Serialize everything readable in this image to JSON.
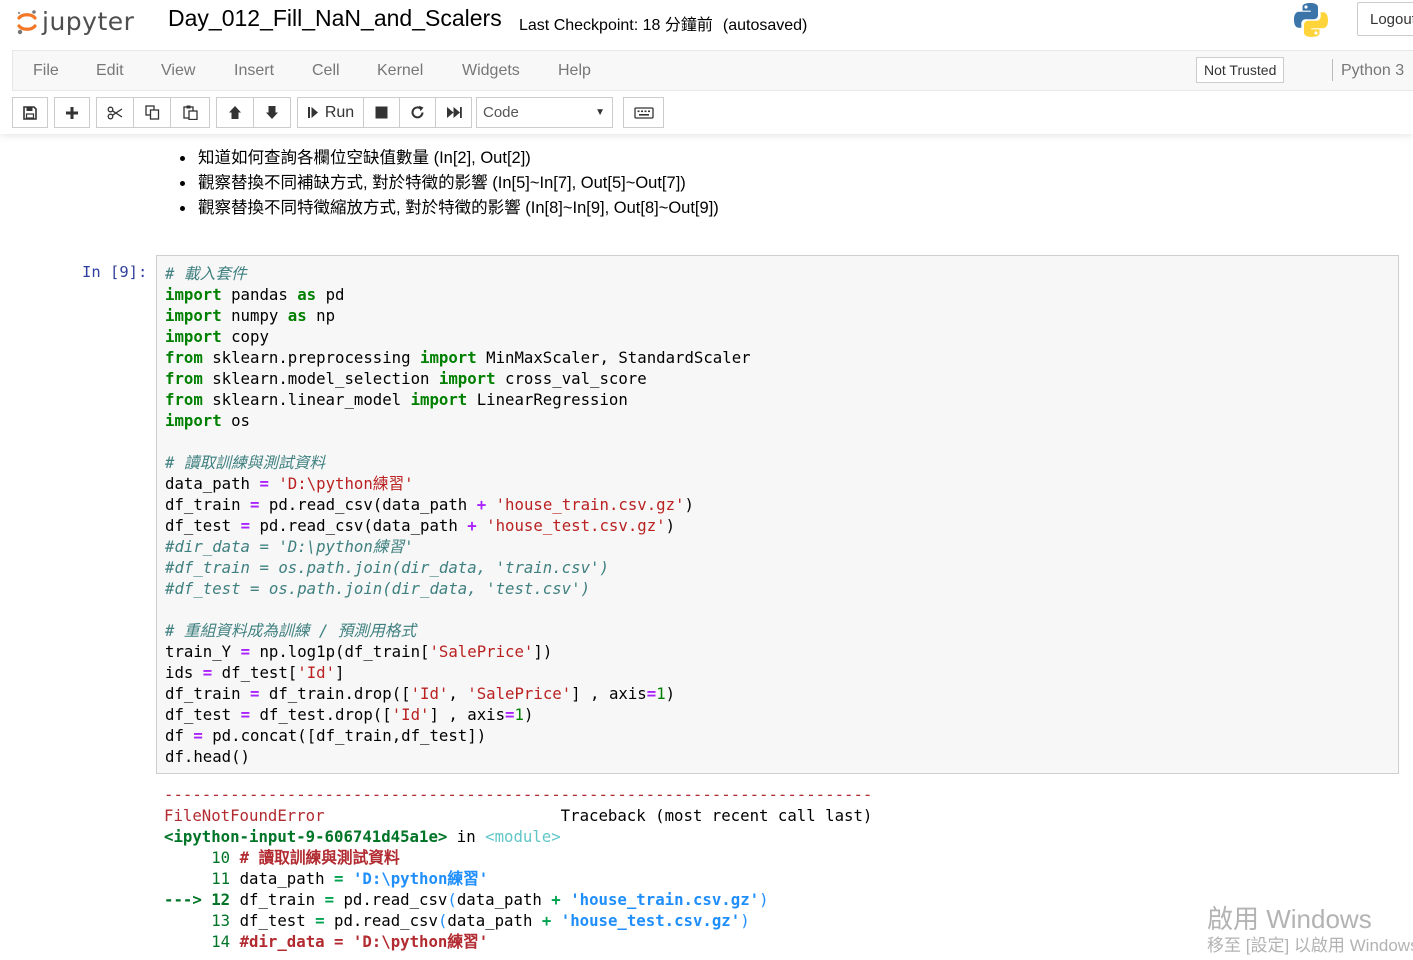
{
  "header": {
    "logo_text": "jupyter",
    "notebook_title": "Day_012_Fill_NaN_and_Scalers",
    "checkpoint_text": "Last Checkpoint: 18 分鐘前",
    "autosave_text": "(autosaved)",
    "logout_label": "Logout"
  },
  "menubar": {
    "items": [
      "File",
      "Edit",
      "View",
      "Insert",
      "Cell",
      "Kernel",
      "Widgets",
      "Help"
    ],
    "trust_label": "Not Trusted",
    "kernel_label": "Python 3"
  },
  "toolbar": {
    "run_label": "Run",
    "cell_type": "Code",
    "icons": [
      "save-icon",
      "plus-icon",
      "cut-icon",
      "copy-icon",
      "paste-icon",
      "arrow-up-icon",
      "arrow-down-icon",
      "run-icon",
      "stop-icon",
      "restart-icon",
      "fast-forward-icon",
      "keyboard-icon"
    ]
  },
  "markdown": {
    "bullets": [
      "知道如何查詢各欄位空缺值數量 (In[2], Out[2])",
      "觀察替換不同補缺方式, 對於特徵的影響 (In[5]~In[7], Out[5]~Out[7])",
      "觀察替換不同特徵縮放方式, 對於特徵的影響 (In[8]~In[9], Out[8]~Out[9])"
    ]
  },
  "cell": {
    "prompt": "In [9]:",
    "code_lines": [
      "# 載入套件",
      "import pandas as pd",
      "import numpy as np",
      "import copy",
      "from sklearn.preprocessing import MinMaxScaler, StandardScaler",
      "from sklearn.model_selection import cross_val_score",
      "from sklearn.linear_model import LinearRegression",
      "import os",
      "",
      "# 讀取訓練與測試資料",
      "data_path = 'D:\\python練習'",
      "df_train = pd.read_csv(data_path + 'house_train.csv.gz')",
      "df_test = pd.read_csv(data_path + 'house_test.csv.gz')",
      "#dir_data = 'D:\\python練習'",
      "#df_train = os.path.join(dir_data, 'train.csv')",
      "#df_test = os.path.join(dir_data, 'test.csv')",
      "",
      "# 重組資料成為訓練 / 預測用格式",
      "train_Y = np.log1p(df_train['SalePrice'])",
      "ids = df_test['Id']",
      "df_train = df_train.drop(['Id', 'SalePrice'] , axis=1)",
      "df_test = df_test.drop(['Id'] , axis=1)",
      "df = pd.concat([df_train,df_test])",
      "df.head()"
    ]
  },
  "output": {
    "lines": [
      "---------------------------------------------------------------------------",
      "FileNotFoundError                         Traceback (most recent call last)",
      "<ipython-input-9-606741d45a1e> in <module>",
      "     10 # 讀取訓練與測試資料",
      "     11 data_path = 'D:\\python練習'",
      "---> 12 df_train = pd.read_csv(data_path + 'house_train.csv.gz')",
      "     13 df_test = pd.read_csv(data_path + 'house_test.csv.gz')",
      "     14 #dir_data = 'D:\\python練習'"
    ]
  },
  "watermark": {
    "line1": "啟用 Windows",
    "line2": "移至 [設定] 以啟用 Windows。"
  },
  "colors": {
    "prompt_in": "#303f9f",
    "keyword": "#008000",
    "comment": "#408080",
    "string": "#ba2121",
    "operator": "#aa22ff",
    "error_red": "#b22b31",
    "jupyter_orange": "#f37726"
  }
}
